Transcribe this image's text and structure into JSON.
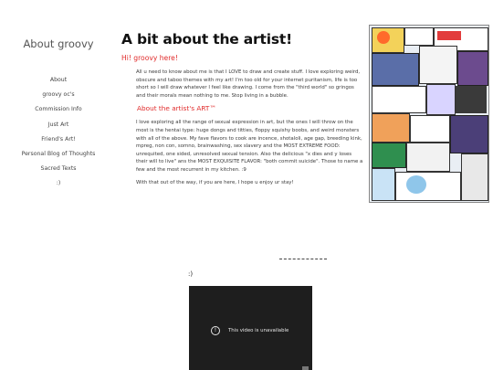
{
  "sidebar": {
    "title": "About groovy",
    "nav": [
      "About",
      "groovy oc's",
      "Commission Info",
      "Just Art",
      "Friend's Art!",
      "Personal Blog of Thoughts",
      "Sacred Texts",
      ":)"
    ]
  },
  "main": {
    "title": "A bit about the artist!",
    "greeting": "Hi! groovy here!",
    "para1": "All u need to know about me is that I LOVE to draw and create stuff. I love exploring weird, obscure and taboo themes with my art! I'm too old for your internet puritanism, life is too short so I will draw whatever I feel like drawing. I come from the \"third world\" so gringos and their morals mean nothing to me. Stop living in a bubble.",
    "subtitle2": "About the artist's ART™",
    "para2": "I love exploring all the range of sexual expression in art, but the ones I will throw on the most is the hentai type: huge dongs and titties, floppy squishy boobs, and weird monsters with all of the above. My fave flavors to cook are incence, shotaloli, age gap, breeding kink, mpreg, non con, somno, brainwashing, sex slavery and the MOST EXTREME FOOD: unrequited, one sided, unresolved sexual tension. Also the delicious \"x dies and y loses their will to live\" ans the MOST EXQUISITE FLAVOR: \"both commit suicide\". Those to name a few and the most recurrent in my kitchen. :9",
    "para3": "With that out of the way, if you are here, I hope u enjoy ur stay!"
  },
  "lower": {
    "divider": "----------------",
    "smiley": ":)",
    "video_message": "This video is unavailable"
  },
  "colors": {
    "accent_red": "#e02a2a",
    "video_bg": "#1e1e1e"
  },
  "icons": {
    "video_alert": "exclamation-circle-icon"
  }
}
